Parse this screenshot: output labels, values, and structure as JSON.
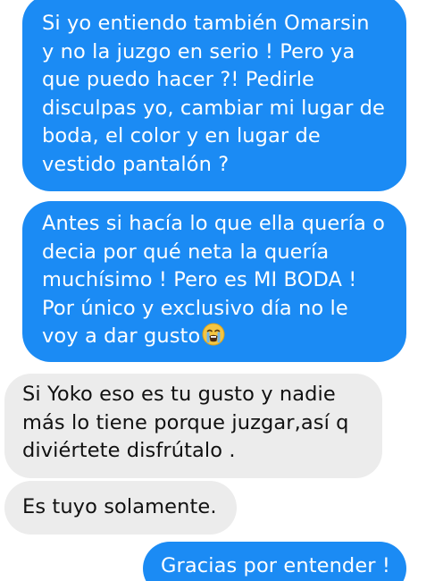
{
  "conversation": {
    "messages": [
      {
        "direction": "sent",
        "text": "Si yo entiendo también Omarsin\ny no la juzgo en serio !  Pero ya\nque puedo hacer ?! Pedirle\ndisculpas yo, cambiar mi lugar de\nboda, el color y en lugar de\nvestido pantalón ?"
      },
      {
        "direction": "sent",
        "text": "Antes si hacía lo que ella quería o\ndecia por qué neta la quería\nmuchísimo ! Pero es MI BODA !\nPor único y exclusivo día no le\nvoy a dar gusto",
        "emoji": "loudly-crying-face"
      },
      {
        "direction": "received",
        "text": "Si Yoko eso es tu gusto y nadie\nmás lo tiene porque juzgar,así q\ndiviértete disfrútalo ."
      },
      {
        "direction": "received",
        "text": "Es tuyo solamente."
      },
      {
        "direction": "sent",
        "text": "Gracias por entender !"
      }
    ]
  },
  "colors": {
    "sent_bubble": "#1b8bf4",
    "sent_text": "#ffffff",
    "received_bubble": "#ececec",
    "received_text": "#111111",
    "background": "#ffffff"
  }
}
